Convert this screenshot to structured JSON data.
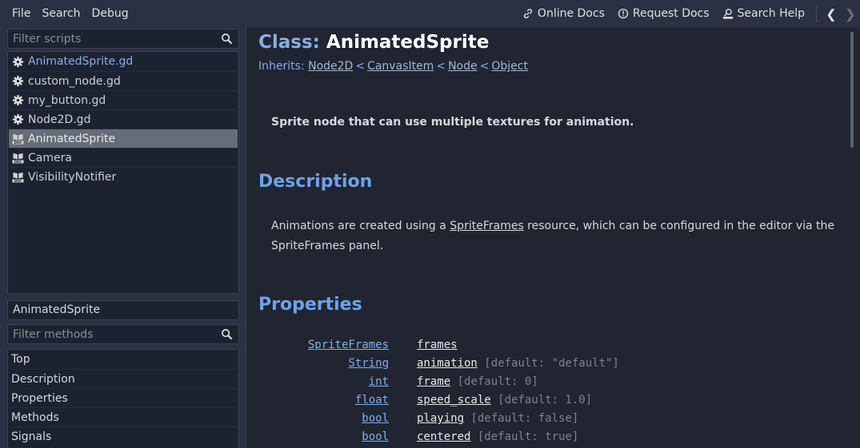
{
  "menu": [
    "File",
    "Search",
    "Debug"
  ],
  "toolbar": {
    "online_docs": "Online Docs",
    "request_docs": "Request Docs",
    "search_help": "Search Help",
    "back_arrow": "❮",
    "forward_arrow": "❯"
  },
  "sidebar": {
    "filter_scripts_placeholder": "Filter scripts",
    "scripts": [
      {
        "label": "AnimatedSprite.gd",
        "icon": "gear-icon"
      },
      {
        "label": "custom_node.gd",
        "icon": "gear-icon"
      },
      {
        "label": "my_button.gd",
        "icon": "gear-icon"
      },
      {
        "label": "Node2D.gd",
        "icon": "gear-icon"
      },
      {
        "label": "AnimatedSprite",
        "icon": "doc-icon",
        "selected": true
      },
      {
        "label": "Camera",
        "icon": "doc-icon"
      },
      {
        "label": "VisibilityNotifier",
        "icon": "doc-icon"
      }
    ],
    "current_class": "AnimatedSprite",
    "filter_methods_placeholder": "Filter methods",
    "sections": [
      "Top",
      "Description",
      "Properties",
      "Methods",
      "Signals"
    ]
  },
  "doc": {
    "class_keyword": "Class:",
    "class_name": "AnimatedSprite",
    "inherits_label": "Inherits:",
    "inherits": [
      "Node2D",
      "CanvasItem",
      "Node",
      "Object"
    ],
    "separator": "<",
    "brief": "Sprite node that can use multiple textures for animation.",
    "description_heading": "Description",
    "description_before": "Animations are created using a ",
    "description_link": "SpriteFrames",
    "description_after": " resource, which can be configured in the editor via the SpriteFrames panel.",
    "properties_heading": "Properties",
    "properties": [
      {
        "type": "SpriteFrames",
        "name": "frames",
        "default": ""
      },
      {
        "type": "String",
        "name": "animation",
        "default": " [default: \"default\"]"
      },
      {
        "type": "int",
        "name": "frame",
        "default": " [default: 0]"
      },
      {
        "type": "float",
        "name": "speed_scale",
        "default": " [default: 1.0]"
      },
      {
        "type": "bool",
        "name": "playing",
        "default": " [default: false]"
      },
      {
        "type": "bool",
        "name": "centered",
        "default": " [default: true]"
      }
    ]
  },
  "colors": {
    "accent": "#6ea2e8",
    "panel": "#2b3142",
    "editor_bg": "#202531",
    "selection": "#666c78"
  }
}
